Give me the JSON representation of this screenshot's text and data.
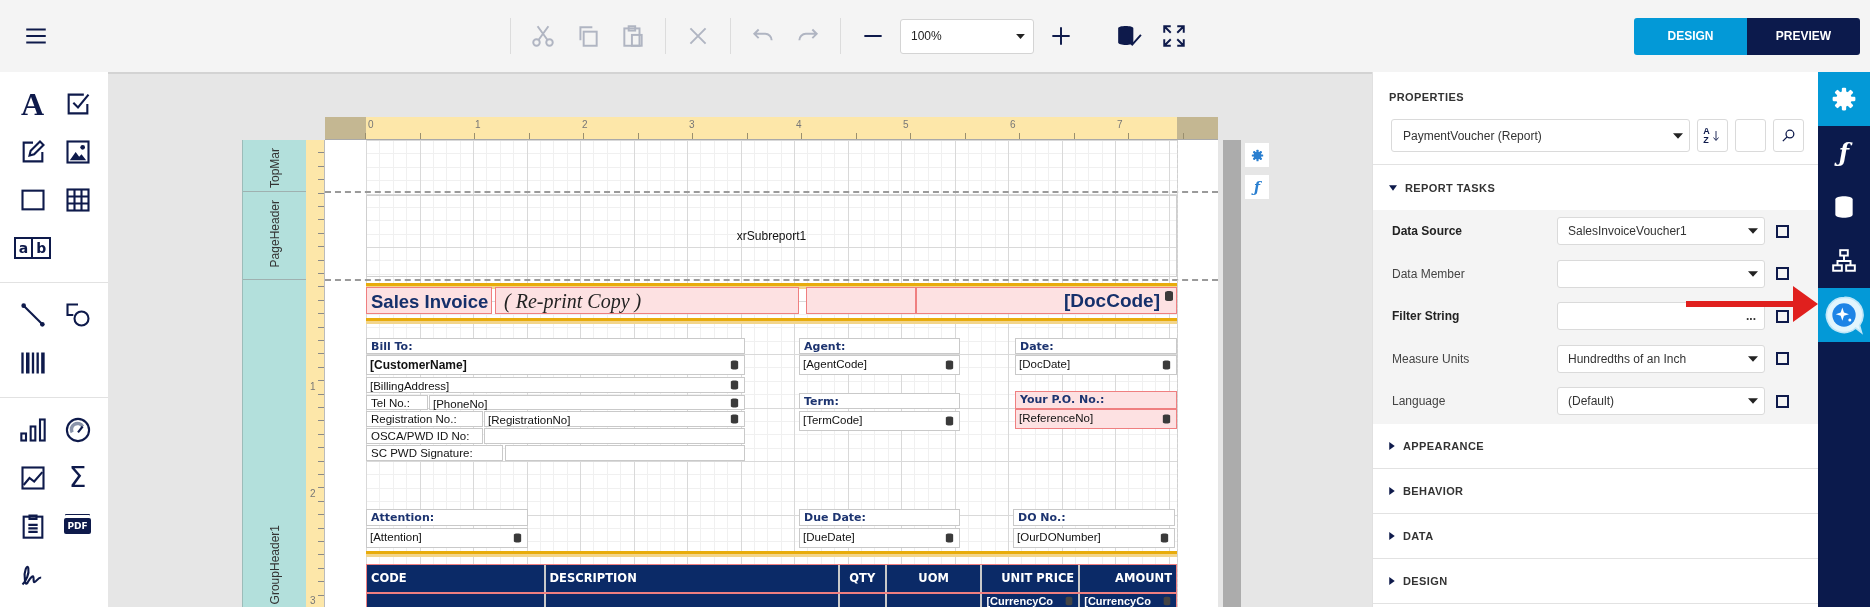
{
  "toolbar": {
    "tool_groups": [
      [
        {
          "kind": "cut",
          "disabled": true
        },
        {
          "kind": "copy",
          "disabled": true
        },
        {
          "kind": "paste",
          "disabled": true
        }
      ],
      [
        {
          "kind": "delete",
          "disabled": true
        }
      ],
      [
        {
          "kind": "undo",
          "disabled": true
        },
        {
          "kind": "redo",
          "disabled": true
        }
      ],
      [
        {
          "kind": "zoom_out",
          "disabled": false
        },
        {
          "kind": "zoom",
          "value": "100%"
        },
        {
          "kind": "zoom_in",
          "disabled": false
        }
      ],
      [
        {
          "kind": "validate",
          "disabled": false
        },
        {
          "kind": "fullscreen",
          "disabled": false
        }
      ]
    ],
    "modes": [
      {
        "label": "DESIGN",
        "selected": true
      },
      {
        "label": "PREVIEW",
        "selected": false
      }
    ]
  },
  "toolbox": {
    "groups": [
      [
        {
          "kind": "text",
          "glyph": "A"
        },
        {
          "kind": "checkbox"
        },
        {
          "kind": "edit"
        },
        {
          "kind": "image"
        },
        {
          "kind": "rectangle"
        },
        {
          "kind": "table"
        },
        {
          "kind": "comb",
          "glyphs": [
            "a",
            "b"
          ]
        }
      ],
      [
        {
          "kind": "line"
        },
        {
          "kind": "shapes"
        },
        {
          "kind": "barcode"
        }
      ],
      [
        {
          "kind": "chart"
        },
        {
          "kind": "gauge"
        },
        {
          "kind": "sparkline"
        },
        {
          "kind": "sum",
          "glyph": "Σ"
        },
        {
          "kind": "clipboard"
        },
        {
          "kind": "pdf",
          "glyph": "PDF"
        },
        {
          "kind": "signature"
        }
      ]
    ]
  },
  "surface": {
    "ruler_numbers": [
      "0",
      "1",
      "2",
      "3",
      "4",
      "5",
      "6",
      "7"
    ],
    "vruler_numbers": [
      "1",
      "2",
      "3"
    ],
    "bands": [
      {
        "name": "TopMar"
      },
      {
        "name": "PageHeader"
      },
      {
        "name": "GroupHeader1"
      }
    ],
    "side_buttons": [
      {
        "kind": "gear"
      },
      {
        "kind": "function",
        "glyph": "ƒ"
      }
    ]
  },
  "report": {
    "subreport": "xrSubreport1",
    "title": {
      "text": "Sales Invoice",
      "subtitle": "( Re-print Copy )",
      "doc_code": "[DocCode]",
      "selected": true
    },
    "controls": [
      {
        "kind": "label",
        "text": "Bill To:",
        "selected": false
      },
      {
        "kind": "field",
        "text": "[CustomerName]",
        "bold": true,
        "bound": true,
        "selected": false
      },
      {
        "kind": "field",
        "text": "[BillingAddress]",
        "bound": true,
        "selected": false
      },
      {
        "kind": "caption",
        "text": "Tel No.:",
        "selected": false
      },
      {
        "kind": "field",
        "text": "[PhoneNo]",
        "bound": true,
        "selected": false
      },
      {
        "kind": "caption",
        "text": "Registration No.:",
        "selected": false
      },
      {
        "kind": "field",
        "text": "[RegistrationNo]",
        "bound": true,
        "selected": false
      },
      {
        "kind": "caption",
        "text": "OSCA/PWD ID No:",
        "selected": false
      },
      {
        "kind": "box",
        "selected": false
      },
      {
        "kind": "caption",
        "text": "SC PWD Signature:",
        "selected": false
      },
      {
        "kind": "box",
        "selected": false
      },
      {
        "kind": "label",
        "text": "Agent:",
        "selected": false
      },
      {
        "kind": "field",
        "text": "[AgentCode]",
        "bound": true,
        "selected": false
      },
      {
        "kind": "label",
        "text": "Term:",
        "selected": false
      },
      {
        "kind": "field",
        "text": "[TermCode]",
        "bound": true,
        "selected": false
      },
      {
        "kind": "label",
        "text": "Date:",
        "selected": false
      },
      {
        "kind": "field",
        "text": "[DocDate]",
        "bound": true,
        "selected": false
      },
      {
        "kind": "label",
        "text": "Your P.O. No.:",
        "selected": true
      },
      {
        "kind": "field",
        "text": "[ReferenceNo]",
        "bound": true,
        "selected": true
      },
      {
        "kind": "label",
        "text": "Attention:",
        "selected": false
      },
      {
        "kind": "field",
        "text": "[Attention]",
        "bound": true,
        "selected": false
      },
      {
        "kind": "label",
        "text": "Due Date:",
        "selected": false
      },
      {
        "kind": "field",
        "text": "[DueDate]",
        "bound": true,
        "selected": false
      },
      {
        "kind": "label",
        "text": "DO No.:",
        "selected": false
      },
      {
        "kind": "field",
        "text": "[OurDONumber]",
        "bound": true,
        "selected": false
      }
    ],
    "table": {
      "columns": [
        "CODE",
        "DESCRIPTION",
        "QTY",
        "UOM",
        "UNIT PRICE",
        "AMOUNT"
      ],
      "row": [
        {
          "bound": false
        },
        {
          "bound": false
        },
        {
          "bound": false
        },
        {
          "bound": false
        },
        {
          "text": "[CurrencyCo",
          "bound": true
        },
        {
          "text": "[CurrencyCo",
          "bound": true
        }
      ]
    }
  },
  "properties": {
    "title": "PROPERTIES",
    "selector": "PaymentVoucher (Report)",
    "sort_letters": [
      "A",
      "Z"
    ],
    "sections": [
      {
        "title": "REPORT TASKS",
        "expanded": true,
        "rows": [
          {
            "label": "Data Source",
            "bold": true,
            "kind": "combo",
            "value": "SalesInvoiceVoucher1",
            "checked": false
          },
          {
            "label": "Data Member",
            "bold": false,
            "kind": "combo",
            "checked": false
          },
          {
            "label": "Filter String",
            "bold": true,
            "kind": "ellipsis",
            "button": "...",
            "checked": false
          },
          {
            "label": "Measure Units",
            "bold": false,
            "kind": "combo",
            "value": "Hundredths of an Inch",
            "checked": false
          },
          {
            "label": "Language",
            "bold": false,
            "kind": "combo",
            "value": "(Default)",
            "checked": false
          }
        ]
      },
      {
        "title": "APPEARANCE",
        "expanded": false
      },
      {
        "title": "BEHAVIOR",
        "expanded": false
      },
      {
        "title": "DATA",
        "expanded": false
      },
      {
        "title": "DESIGN",
        "expanded": false
      }
    ]
  },
  "sidebar_tabs": [
    {
      "kind": "properties",
      "selected": true
    },
    {
      "kind": "expressions",
      "glyph": "ƒ",
      "selected": false
    },
    {
      "kind": "data",
      "selected": false
    },
    {
      "kind": "outline",
      "selected": false
    },
    {
      "kind": "ai",
      "selected": true
    }
  ]
}
